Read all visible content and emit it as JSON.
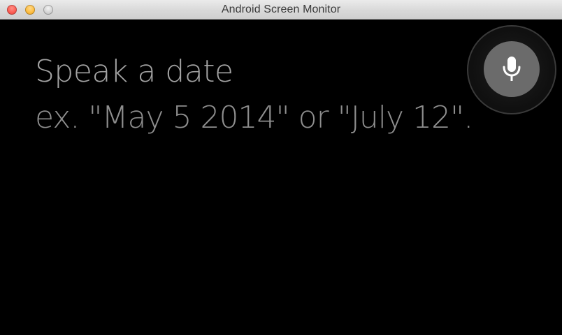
{
  "window": {
    "title": "Android Screen Monitor"
  },
  "screen": {
    "prompt_title": "Speak a date",
    "prompt_example": "ex. \"May 5 2014\" or \"July 12\"."
  },
  "icons": {
    "mic": "microphone-icon"
  },
  "colors": {
    "background": "#000000",
    "text": "#9a9a9a",
    "mic_button": "#6b6b6b"
  }
}
